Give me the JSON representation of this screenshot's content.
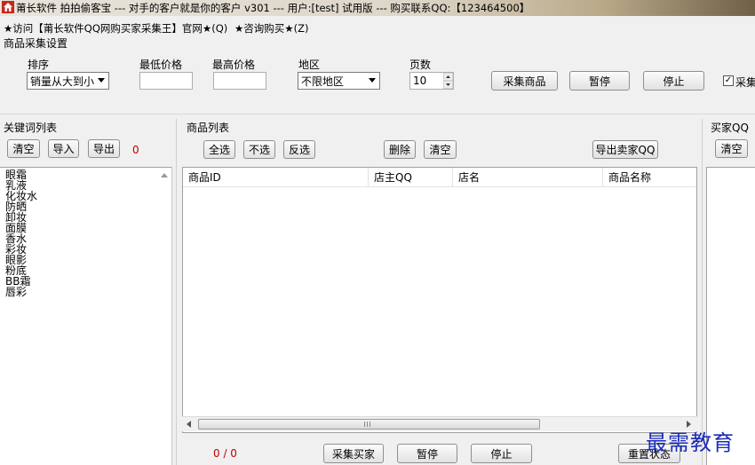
{
  "window": {
    "title": "莆长软件 拍拍偷客宝 --- 对手的客户就是你的客户 v301 --- 用户:[test] 试用版 --- 购买联系QQ:【123464500】",
    "icon": "app-home-icon"
  },
  "menu": [
    "★访问【莆长软件QQ网购买家采集王】官网★(Q)",
    "★咨询购买★(Z)"
  ],
  "settings": {
    "group_label": "商品采集设置",
    "sort_label": "排序",
    "sort_value": "销量从大到小",
    "min_price_label": "最低价格",
    "max_price_label": "最高价格",
    "min_price_value": "",
    "max_price_value": "",
    "region_label": "地区",
    "region_value": "不限地区",
    "pages_label": "页数",
    "pages_value": "10",
    "collect_goods_button": "采集商品",
    "pause_button": "暂停",
    "stop_button": "停止",
    "checkbox_label": "采集",
    "checkbox_checked": true
  },
  "keywords": {
    "group_label": "关键词列表",
    "clear_button": "清空",
    "import_button": "导入",
    "export_button": "导出",
    "count": "0",
    "items": [
      "眼霜",
      "乳液",
      "化妆水",
      "防晒",
      "卸妆",
      "面膜",
      "香水",
      "彩妆",
      "眼影",
      "粉底",
      "BB霜",
      "唇彩"
    ]
  },
  "goods": {
    "group_label": "商品列表",
    "select_all_button": "全选",
    "select_none_button": "不选",
    "invert_button": "反选",
    "delete_button": "删除",
    "clear_button": "清空",
    "export_seller_button": "导出卖家QQ",
    "columns": [
      "商品ID",
      "店主QQ",
      "店名",
      "商品名称"
    ],
    "progress": "0 / 0",
    "collect_buyers_button": "采集买家",
    "pause_button": "暂停",
    "stop_button": "停止",
    "reset_button": "重置状态"
  },
  "buyers": {
    "group_label": "买家QQ",
    "clear_button": "清空"
  },
  "watermark": "最需教育"
}
